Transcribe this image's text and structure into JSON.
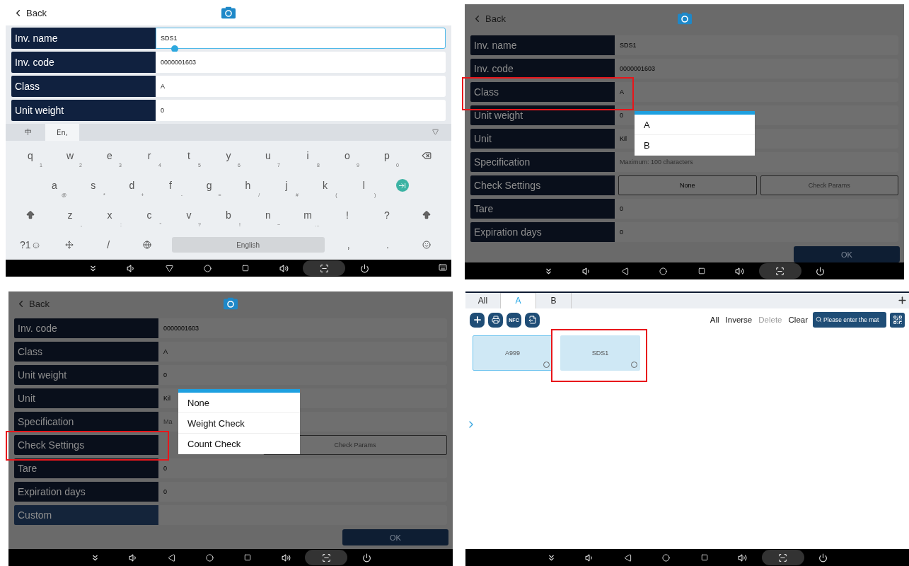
{
  "panels": [
    {
      "kind": "form",
      "dimmed": false,
      "back": "Back",
      "fields": [
        {
          "label": "Inv. name",
          "kind": "text",
          "value": "SDS1",
          "focused": true,
          "highlighted": false
        },
        {
          "label": "Inv. code",
          "kind": "text",
          "value": "0000001603",
          "focused": false,
          "highlighted": false
        },
        {
          "label": "Class",
          "kind": "text",
          "value": "A",
          "focused": false,
          "highlighted": false
        },
        {
          "label": "Unit weight",
          "kind": "text",
          "value": "0",
          "focused": false,
          "highlighted": false
        }
      ],
      "keyboard": {
        "tabs": [
          {
            "label": "中",
            "selected": false
          },
          {
            "label": "En,",
            "selected": true
          }
        ],
        "rows": [
          {
            "keys": [
              {
                "kind": "char",
                "main": "q",
                "sub": "1"
              },
              {
                "kind": "char",
                "main": "w",
                "sub": "2"
              },
              {
                "kind": "char",
                "main": "e",
                "sub": "3"
              },
              {
                "kind": "char",
                "main": "r",
                "sub": "4"
              },
              {
                "kind": "char",
                "main": "t",
                "sub": "5"
              },
              {
                "kind": "char",
                "main": "y",
                "sub": "6"
              },
              {
                "kind": "char",
                "main": "u",
                "sub": "7"
              },
              {
                "kind": "char",
                "main": "i",
                "sub": "8"
              },
              {
                "kind": "char",
                "main": "o",
                "sub": "9"
              },
              {
                "kind": "char",
                "main": "p",
                "sub": "0"
              },
              {
                "kind": "backspace"
              }
            ]
          },
          {
            "keys": [
              {
                "kind": "char",
                "main": "a",
                "sub": "@"
              },
              {
                "kind": "char",
                "main": "s",
                "sub": "*"
              },
              {
                "kind": "char",
                "main": "d",
                "sub": "+"
              },
              {
                "kind": "char",
                "main": "f",
                "sub": "-"
              },
              {
                "kind": "char",
                "main": "g",
                "sub": "="
              },
              {
                "kind": "char",
                "main": "h",
                "sub": "/"
              },
              {
                "kind": "char",
                "main": "j",
                "sub": "#"
              },
              {
                "kind": "char",
                "main": "k",
                "sub": "("
              },
              {
                "kind": "char",
                "main": "l",
                "sub": ")"
              },
              {
                "kind": "enter"
              }
            ]
          },
          {
            "keys": [
              {
                "kind": "shift"
              },
              {
                "kind": "char",
                "main": "z",
                "sub": ","
              },
              {
                "kind": "char",
                "main": "x",
                "sub": ":"
              },
              {
                "kind": "char",
                "main": "c",
                "sub": "\""
              },
              {
                "kind": "char",
                "main": "v",
                "sub": "?"
              },
              {
                "kind": "char",
                "main": "b",
                "sub": "!"
              },
              {
                "kind": "char",
                "main": "n",
                "sub": "~"
              },
              {
                "kind": "char",
                "main": "m",
                "sub": "…"
              },
              {
                "kind": "char",
                "main": "!"
              },
              {
                "kind": "char",
                "main": "?"
              },
              {
                "kind": "shift"
              }
            ]
          },
          {
            "keys": [
              {
                "kind": "char",
                "main": "?1☺"
              },
              {
                "kind": "move"
              },
              {
                "kind": "char",
                "main": "/"
              },
              {
                "kind": "globe"
              },
              {
                "kind": "space",
                "main": "English"
              },
              {
                "kind": "char",
                "main": ","
              },
              {
                "kind": "char",
                "main": "."
              },
              {
                "kind": "emoji"
              }
            ]
          }
        ]
      },
      "nav_bar": [
        {
          "kind": "collapse"
        },
        {
          "kind": "vol_down"
        },
        {
          "kind": "hide"
        },
        {
          "kind": "home"
        },
        {
          "kind": "recents"
        },
        {
          "kind": "vol_up"
        },
        {
          "kind": "screenshot"
        },
        {
          "kind": "power"
        },
        {
          "kind": "keyboard"
        }
      ]
    },
    {
      "kind": "form",
      "dimmed": true,
      "back": "Back",
      "fields": [
        {
          "label": "Inv. name",
          "kind": "text",
          "value": "SDS1",
          "focused": false,
          "highlighted": false
        },
        {
          "label": "Inv. code",
          "kind": "text",
          "value": "0000001603",
          "focused": false,
          "highlighted": false
        },
        {
          "label": "Class",
          "kind": "text",
          "value": "A",
          "focused": false,
          "highlighted": true
        },
        {
          "label": "Unit weight",
          "kind": "text",
          "value": "0",
          "focused": false,
          "highlighted": false
        },
        {
          "label": "Unit",
          "kind": "text",
          "value": "Kil",
          "focused": false,
          "highlighted": false
        },
        {
          "label": "Specification",
          "kind": "text",
          "placeholder": "Maximum: 100 characters",
          "focused": false,
          "highlighted": false
        },
        {
          "label": "Check Settings",
          "kind": "buttons",
          "buttons": [
            {
              "label": "None",
              "disabled": false
            },
            {
              "label": "Check Params",
              "disabled": true
            }
          ],
          "highlighted": false
        },
        {
          "label": "Tare",
          "kind": "text",
          "value": "0",
          "focused": false,
          "highlighted": false
        },
        {
          "label": "Expiration days",
          "kind": "text",
          "value": "0",
          "focused": false,
          "highlighted": false
        }
      ],
      "ok": "OK",
      "popup": {
        "options": [
          "A",
          "B"
        ]
      },
      "nav_bar": [
        {
          "kind": "collapse"
        },
        {
          "kind": "vol_down"
        },
        {
          "kind": "back"
        },
        {
          "kind": "home"
        },
        {
          "kind": "recents"
        },
        {
          "kind": "vol_up"
        },
        {
          "kind": "screenshot"
        },
        {
          "kind": "power"
        }
      ]
    },
    {
      "kind": "form",
      "dimmed": true,
      "back": "Back",
      "fields": [
        {
          "label": "Inv. code",
          "kind": "text",
          "value": "0000001603",
          "focused": false,
          "highlighted": false
        },
        {
          "label": "Class",
          "kind": "text",
          "value": "A",
          "focused": false,
          "highlighted": false
        },
        {
          "label": "Unit weight",
          "kind": "text",
          "value": "0",
          "focused": false,
          "highlighted": false
        },
        {
          "label": "Unit",
          "kind": "text",
          "value": "Kil",
          "focused": false,
          "highlighted": false
        },
        {
          "label": "Specification",
          "kind": "text",
          "placeholder": "Ma",
          "focused": false,
          "highlighted": false
        },
        {
          "label": "Check Settings",
          "kind": "buttons",
          "buttons": [
            {
              "label": "Check Params",
              "disabled": true
            }
          ],
          "highlighted": true
        },
        {
          "label": "Tare",
          "kind": "text",
          "value": "0",
          "focused": false,
          "highlighted": false
        },
        {
          "label": "Expiration days",
          "kind": "text",
          "value": "0",
          "focused": false,
          "highlighted": false
        },
        {
          "label": "Custom",
          "kind": "custom",
          "highlighted": false
        }
      ],
      "ok": "OK",
      "popup": {
        "options": [
          "None",
          "Weight Check",
          "Count Check"
        ]
      },
      "nav_bar": [
        {
          "kind": "collapse"
        },
        {
          "kind": "vol_down"
        },
        {
          "kind": "back"
        },
        {
          "kind": "home"
        },
        {
          "kind": "recents"
        },
        {
          "kind": "vol_up"
        },
        {
          "kind": "screenshot"
        },
        {
          "kind": "power"
        }
      ]
    },
    {
      "kind": "list",
      "tabs": [
        {
          "label": "All",
          "selected": false
        },
        {
          "label": "A",
          "selected": true
        },
        {
          "label": "B",
          "selected": false
        }
      ],
      "tools": [
        {
          "kind": "add"
        },
        {
          "kind": "print"
        },
        {
          "kind": "nfc",
          "label": "NFC"
        },
        {
          "kind": "export"
        }
      ],
      "actions": [
        {
          "label": "All",
          "disabled": false
        },
        {
          "label": "Inverse",
          "disabled": false
        },
        {
          "label": "Delete",
          "disabled": true
        },
        {
          "label": "Clear",
          "disabled": false
        }
      ],
      "search": {
        "placeholder": "Please enter the mat"
      },
      "cards": [
        {
          "label": "A999",
          "selected": true,
          "highlighted": false
        },
        {
          "label": "SDS1",
          "selected": false,
          "highlighted": true
        }
      ],
      "nav_bar": [
        {
          "kind": "collapse"
        },
        {
          "kind": "vol_down"
        },
        {
          "kind": "back"
        },
        {
          "kind": "home"
        },
        {
          "kind": "recents"
        },
        {
          "kind": "vol_up"
        },
        {
          "kind": "screenshot"
        },
        {
          "kind": "power"
        }
      ]
    }
  ]
}
